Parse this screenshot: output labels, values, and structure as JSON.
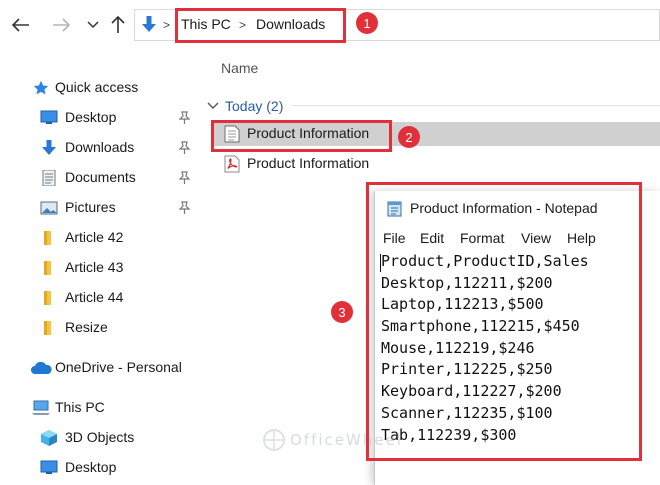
{
  "address_bar": {
    "crumbs": [
      "This PC",
      "Downloads"
    ],
    "separator": ">"
  },
  "nav_pane": {
    "items": [
      {
        "label": "Quick access",
        "icon": "star-icon"
      },
      {
        "label": "Desktop",
        "icon": "desktop-icon",
        "pinned": true
      },
      {
        "label": "Downloads",
        "icon": "download-arrow-icon",
        "pinned": true
      },
      {
        "label": "Documents",
        "icon": "documents-icon",
        "pinned": true
      },
      {
        "label": "Pictures",
        "icon": "pictures-icon",
        "pinned": true
      },
      {
        "label": "Article 42",
        "icon": "folder-icon"
      },
      {
        "label": "Article 43",
        "icon": "folder-icon"
      },
      {
        "label": "Article 44",
        "icon": "folder-icon"
      },
      {
        "label": "Resize",
        "icon": "folder-icon"
      },
      {
        "label": "OneDrive - Personal",
        "icon": "cloud-icon"
      },
      {
        "label": "This PC",
        "icon": "computer-icon"
      },
      {
        "label": "3D Objects",
        "icon": "cube-icon"
      },
      {
        "label": "Desktop",
        "icon": "desktop-icon"
      }
    ]
  },
  "content": {
    "column_header": "Name",
    "group_label": "Today (2)",
    "files": [
      {
        "name": "Product Information",
        "type": "text",
        "selected": true
      },
      {
        "name": "Product Information",
        "type": "pdf",
        "selected": false
      }
    ]
  },
  "notepad": {
    "title": "Product Information - Notepad",
    "menu": [
      "File",
      "Edit",
      "Format",
      "View",
      "Help"
    ],
    "lines": [
      "Product,ProductID,Sales",
      "Desktop,112211,$200",
      "Laptop,112213,$500",
      "Smartphone,112215,$450",
      "Mouse,112219,$246",
      "Printer,112225,$250",
      "Keyboard,112227,$200",
      "Scanner,112235,$100",
      "Tab,112239,$300"
    ]
  },
  "annotations": {
    "badge_1": "1",
    "badge_2": "2",
    "badge_3": "3",
    "color": "#e0303a"
  },
  "watermark": "OfficeWheel",
  "colors": {
    "group_label": "#2a5aa8",
    "selected_row": "#d0d0d0",
    "annotation": "#e0303a"
  }
}
